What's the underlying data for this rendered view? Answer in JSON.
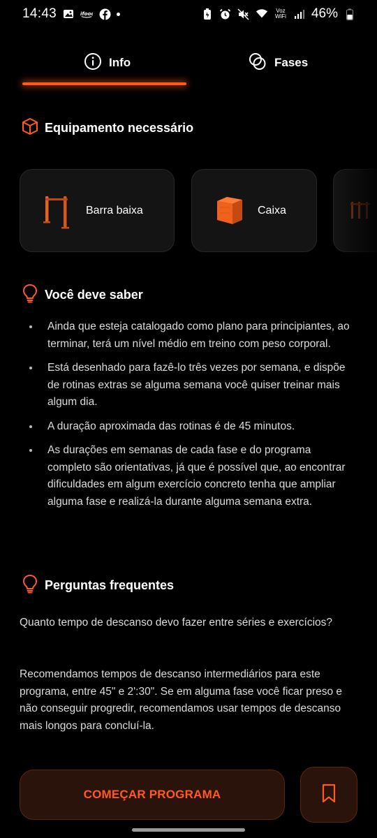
{
  "status_bar": {
    "time": "14:43",
    "network_label": "Voz WiFi",
    "battery": "46%",
    "icons": [
      "gallery-icon",
      "ifood-icon",
      "facebook-icon",
      "dot-icon",
      "battery-saver-icon",
      "alarm-icon",
      "mute-icon",
      "wifi-icon",
      "signal-icon",
      "battery-icon"
    ]
  },
  "tabs": [
    {
      "label": "Info",
      "icon": "info-icon",
      "active": true
    },
    {
      "label": "Fases",
      "icon": "phases-icon",
      "active": false
    }
  ],
  "accent_color": "#ff5a1f",
  "equipment": {
    "title": "Equipamento necessário",
    "icon": "box-outline-icon",
    "items": [
      {
        "label": "Barra baixa",
        "icon": "low-bar-icon"
      },
      {
        "label": "Caixa",
        "icon": "box-icon"
      },
      {
        "label": "",
        "icon": "parallel-bars-icon"
      }
    ]
  },
  "should_know": {
    "title": "Você deve saber",
    "icon": "lightbulb-icon",
    "items": [
      "Ainda que esteja catalogado como plano para principiantes, ao terminar, terá um nível médio em treino com peso corporal.",
      "Está desenhado para fazê-lo três vezes por semana, e dispõe de rotinas extras se alguma semana você quiser treinar mais algum dia.",
      "A duração aproximada das rotinas é de 45 minutos.",
      "As durações em semanas de cada fase e do programa completo são orientativas, já que é possível que, ao encontrar dificuldades em algum exercício concreto tenha que ampliar alguma fase e realizá-la durante alguma semana extra."
    ]
  },
  "faq": {
    "title": "Perguntas frequentes",
    "icon": "lightbulb-icon",
    "question": "Quanto tempo de descanso devo fazer entre séries e exercícios?",
    "answer": "Recomendamos tempos de descanso intermediários para este programa, entre 45\" e 2':30\". Se em alguma fase você ficar preso e não conseguir progredir, recomendamos usar tempos de descanso mais longos para concluí-la."
  },
  "actions": {
    "start_label": "COMEÇAR PROGRAMA",
    "bookmark_icon": "bookmark-icon"
  }
}
